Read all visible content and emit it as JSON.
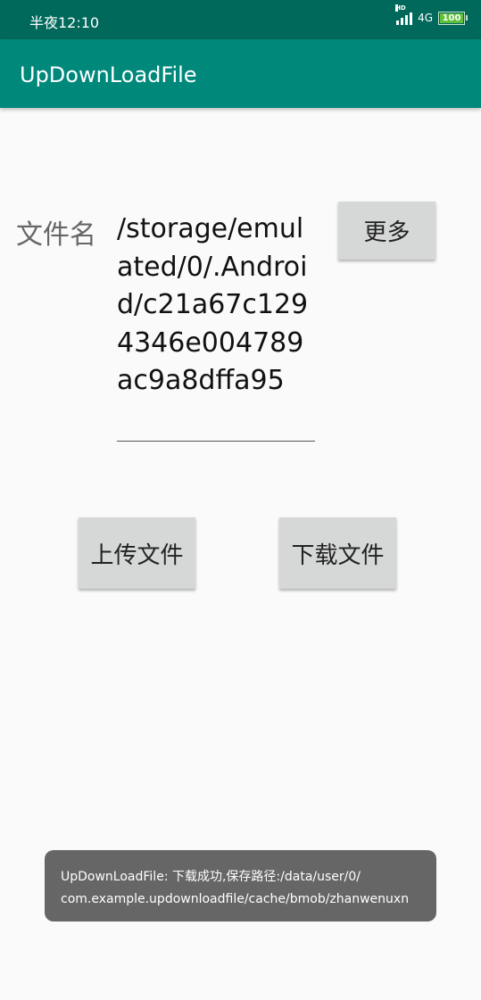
{
  "status_bar": {
    "time": "半夜12:10",
    "hd": "HD",
    "network": "4G",
    "battery": "100"
  },
  "app_bar": {
    "title": "UpDownLoadFile"
  },
  "form": {
    "filename_label": "文件名",
    "path_value": "/storage/emulated/0/.Android/c21a67c1294346e004789ac9a8dffa95",
    "more_button": "更多",
    "upload_button": "上传文件",
    "download_button": "下载文件"
  },
  "toast": {
    "line1": "UpDownLoadFile: 下载成功,保存路径:/data/user/0/",
    "line2": "com.example.updownloadfile/cache/bmob/zhanwenuxn"
  },
  "colors": {
    "status_bar": "#00695c",
    "app_bar": "#00897b",
    "button": "#d6d7d7",
    "toast": "#666666",
    "background": "#fafafa"
  },
  "icons": [
    "signal-icon",
    "battery-icon"
  ]
}
